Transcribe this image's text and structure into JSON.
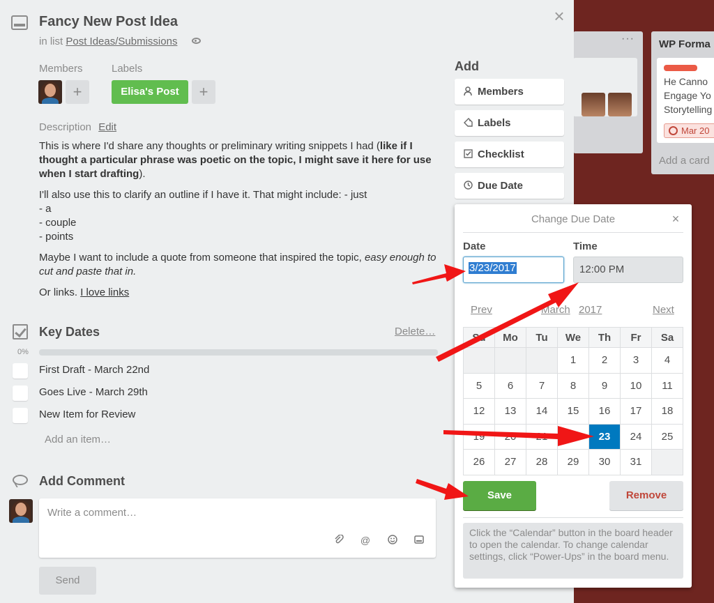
{
  "board": {
    "list1": {
      "menu_dots": "···"
    },
    "list2": {
      "title": "WP Forma",
      "card_text": [
        "He Canno",
        "Engage Yo",
        "Storytelling"
      ],
      "due_badge": "Mar 20",
      "add_card": "Add a card"
    }
  },
  "card": {
    "title": "Fancy New Post Idea",
    "in_list_prefix": "in list",
    "list_name": "Post Ideas/Submissions",
    "close": "×",
    "members_label": "Members",
    "labels_label": "Labels",
    "label_name": "Elisa's Post",
    "label_color": "#61bd4f",
    "plus": "+",
    "description_label": "Description",
    "description_edit": "Edit",
    "description": {
      "p1_start": "This is where I'd share any thoughts or preliminary writing snippets I had (",
      "p1_bold": "like if I thought a particular phrase was poetic on the topic, I might save it here for use when I start drafting",
      "p1_end": ").",
      "p2_lines": [
        "I'll also use this to clarify an outline if I have it. That might include: - just",
        "- a",
        "- couple",
        "- points"
      ],
      "p3_start": "Maybe I want to include a quote from someone that inspired the topic, ",
      "p3_italic": "easy enough to cut and paste that in.",
      "p4_start": "Or links. ",
      "p4_link": "I love links"
    },
    "checklist": {
      "title": "Key Dates",
      "delete": "Delete…",
      "percent": "0%",
      "progress": 0,
      "items": [
        "First Draft - March 22nd",
        "Goes Live - March 29th",
        "New Item for Review"
      ],
      "add_item": "Add an item…"
    },
    "comment": {
      "title": "Add Comment",
      "placeholder": "Write a comment…",
      "send": "Send"
    }
  },
  "sidebar": {
    "add_title": "Add",
    "buttons": [
      {
        "label": "Members",
        "icon": "person-icon"
      },
      {
        "label": "Labels",
        "icon": "tag-icon"
      },
      {
        "label": "Checklist",
        "icon": "checkbox-icon"
      },
      {
        "label": "Due Date",
        "icon": "clock-icon"
      }
    ]
  },
  "due_date_popover": {
    "title": "Change Due Date",
    "close": "×",
    "date_label": "Date",
    "date_value": "3/23/2017",
    "time_label": "Time",
    "time_value": "12:00 PM",
    "prev": "Prev",
    "month": "March",
    "year": "2017",
    "next": "Next",
    "weekdays": [
      "Su",
      "Mo",
      "Tu",
      "We",
      "Th",
      "Fr",
      "Sa"
    ],
    "weeks": [
      [
        "",
        "",
        "",
        "1",
        "2",
        "3",
        "4"
      ],
      [
        "5",
        "6",
        "7",
        "8",
        "9",
        "10",
        "11"
      ],
      [
        "12",
        "13",
        "14",
        "15",
        "16",
        "17",
        "18"
      ],
      [
        "19",
        "20",
        "21",
        "22",
        "23",
        "24",
        "25"
      ],
      [
        "26",
        "27",
        "28",
        "29",
        "30",
        "31",
        ""
      ]
    ],
    "selected_day": "23",
    "save": "Save",
    "remove": "Remove",
    "hint": "Click the “Calendar” button in the board header to open the calendar. To change calendar settings, click “Power-Ups” in the board menu."
  },
  "colors": {
    "accent_blue": "#0079bf",
    "save_green": "#5aac44",
    "remove_red": "#c0473a",
    "arrow_red": "#f01616",
    "board_bg": "#6e2520"
  }
}
